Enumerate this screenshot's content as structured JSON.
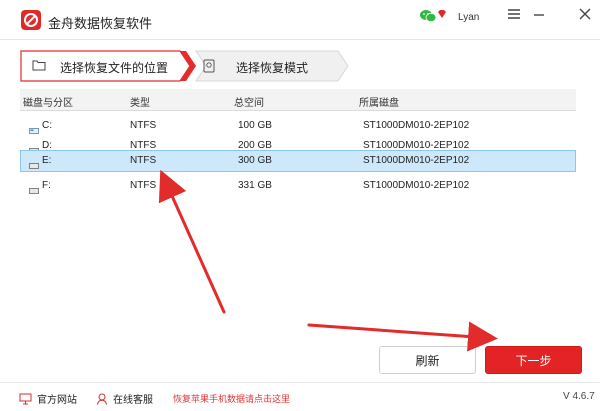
{
  "app": {
    "title": "金舟数据恢复软件",
    "user": "Lyan"
  },
  "steps": [
    {
      "label": "选择恢复文件的位置",
      "active": true
    },
    {
      "label": "选择恢复模式",
      "active": false
    }
  ],
  "table": {
    "headers": [
      "磁盘与分区",
      "类型",
      "总空间",
      "所属磁盘"
    ],
    "rows": [
      {
        "drive": "C:",
        "type": "NTFS",
        "size": "100 GB",
        "disk": "ST1000DM010-2EP102",
        "selected": false
      },
      {
        "drive": "D:",
        "type": "NTFS",
        "size": "200 GB",
        "disk": "ST1000DM010-2EP102",
        "selected": false
      },
      {
        "drive": "E:",
        "type": "NTFS",
        "size": "300 GB",
        "disk": "ST1000DM010-2EP102",
        "selected": true
      },
      {
        "drive": "F:",
        "type": "NTFS",
        "size": "331 GB",
        "disk": "ST1000DM010-2EP102",
        "selected": false
      }
    ]
  },
  "buttons": {
    "refresh": "刷新",
    "next": "下一步"
  },
  "footer": {
    "website": "官方网站",
    "support": "在线客服",
    "promo": "恢复苹果手机数据请点击这里",
    "version": "V 4.6.7"
  },
  "colors": {
    "accent": "#e42424",
    "selection": "#cde8fb",
    "step_active_border": "#e52b2b"
  },
  "icons": [
    "app-logo-icon",
    "wechat-icon",
    "vip-diamond-icon",
    "menu-icon",
    "minimize-icon",
    "close-icon",
    "folder-icon",
    "hard-disk-icon",
    "drive-icon",
    "monitor-icon",
    "headset-icon"
  ]
}
